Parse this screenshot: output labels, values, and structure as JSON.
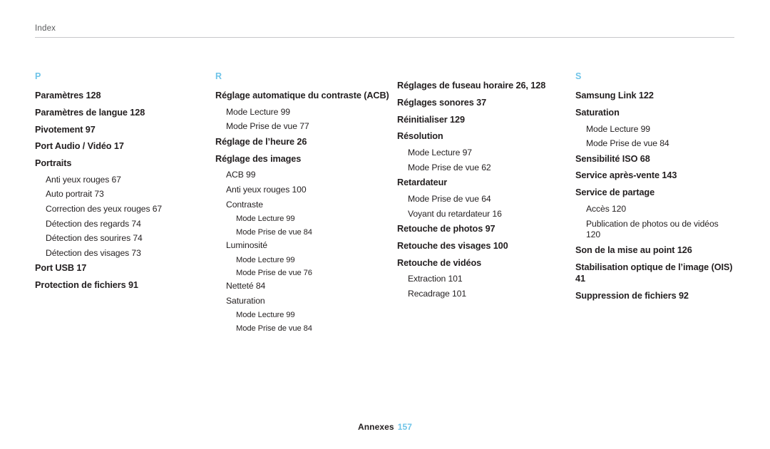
{
  "header": {
    "label": "Index"
  },
  "footer": {
    "text": "Annexes",
    "page": "157"
  },
  "columns": [
    {
      "letter": "P",
      "entries": [
        {
          "level": 1,
          "text": "Paramètres  128"
        },
        {
          "level": 1,
          "text": "Paramètres de langue  128"
        },
        {
          "level": 1,
          "text": "Pivotement  97"
        },
        {
          "level": 1,
          "text": "Port Audio / Vidéo  17"
        },
        {
          "level": 1,
          "text": "Portraits"
        },
        {
          "level": 2,
          "text": "Anti yeux rouges  67"
        },
        {
          "level": 2,
          "text": "Auto portrait  73"
        },
        {
          "level": 2,
          "text": "Correction des yeux rouges  67"
        },
        {
          "level": 2,
          "text": "Détection des regards  74"
        },
        {
          "level": 2,
          "text": "Détection des sourires  74"
        },
        {
          "level": 2,
          "text": "Détection des visages  73"
        },
        {
          "level": 1,
          "text": "Port USB  17"
        },
        {
          "level": 1,
          "text": "Protection de fichiers  91"
        }
      ]
    },
    {
      "letter": "R",
      "entries": [
        {
          "level": 1,
          "text": "Réglage automatique du contraste (ACB)"
        },
        {
          "level": 2,
          "text": "Mode Lecture  99"
        },
        {
          "level": 2,
          "text": "Mode Prise de vue  77"
        },
        {
          "level": 1,
          "text": "Réglage de l’heure  26"
        },
        {
          "level": 1,
          "text": "Réglage des images"
        },
        {
          "level": 2,
          "text": "ACB  99"
        },
        {
          "level": 2,
          "text": "Anti yeux rouges  100"
        },
        {
          "level": 2,
          "text": "Contraste"
        },
        {
          "level": 3,
          "text": "Mode Lecture  99"
        },
        {
          "level": 3,
          "text": "Mode Prise de vue  84"
        },
        {
          "level": 2,
          "text": "Luminosité"
        },
        {
          "level": 3,
          "text": "Mode Lecture  99"
        },
        {
          "level": 3,
          "text": "Mode Prise de vue  76"
        },
        {
          "level": 2,
          "text": "Netteté  84"
        },
        {
          "level": 2,
          "text": "Saturation"
        },
        {
          "level": 3,
          "text": "Mode Lecture  99"
        },
        {
          "level": 3,
          "text": "Mode Prise de vue  84"
        }
      ]
    },
    {
      "letter": "",
      "entries": [
        {
          "level": 1,
          "text": "Réglages de fuseau horaire  26, 128"
        },
        {
          "level": 1,
          "text": "Réglages sonores  37"
        },
        {
          "level": 1,
          "text": "Réinitialiser  129"
        },
        {
          "level": 1,
          "text": "Résolution"
        },
        {
          "level": 2,
          "text": "Mode Lecture  97"
        },
        {
          "level": 2,
          "text": "Mode Prise de vue  62"
        },
        {
          "level": 1,
          "text": "Retardateur"
        },
        {
          "level": 2,
          "text": "Mode Prise de vue  64"
        },
        {
          "level": 2,
          "text": "Voyant du retardateur  16"
        },
        {
          "level": 1,
          "text": "Retouche de photos  97"
        },
        {
          "level": 1,
          "text": "Retouche des visages  100"
        },
        {
          "level": 1,
          "text": "Retouche de vidéos"
        },
        {
          "level": 2,
          "text": "Extraction  101"
        },
        {
          "level": 2,
          "text": "Recadrage  101"
        }
      ]
    },
    {
      "letter": "S",
      "entries": [
        {
          "level": 1,
          "text": "Samsung Link  122"
        },
        {
          "level": 1,
          "text": "Saturation"
        },
        {
          "level": 2,
          "text": "Mode Lecture  99"
        },
        {
          "level": 2,
          "text": "Mode Prise de vue  84"
        },
        {
          "level": 1,
          "text": "Sensibilité ISO  68"
        },
        {
          "level": 1,
          "text": "Service après-vente  143"
        },
        {
          "level": 1,
          "text": "Service de partage"
        },
        {
          "level": 2,
          "text": "Accès  120"
        },
        {
          "level": 2,
          "text": "Publication de photos ou de vidéos  120"
        },
        {
          "level": 1,
          "text": "Son de la mise au point  126"
        },
        {
          "level": 1,
          "text": "Stabilisation optique de l’image (OIS)  41"
        },
        {
          "level": 1,
          "text": "Suppression de fichiers  92"
        }
      ]
    }
  ]
}
